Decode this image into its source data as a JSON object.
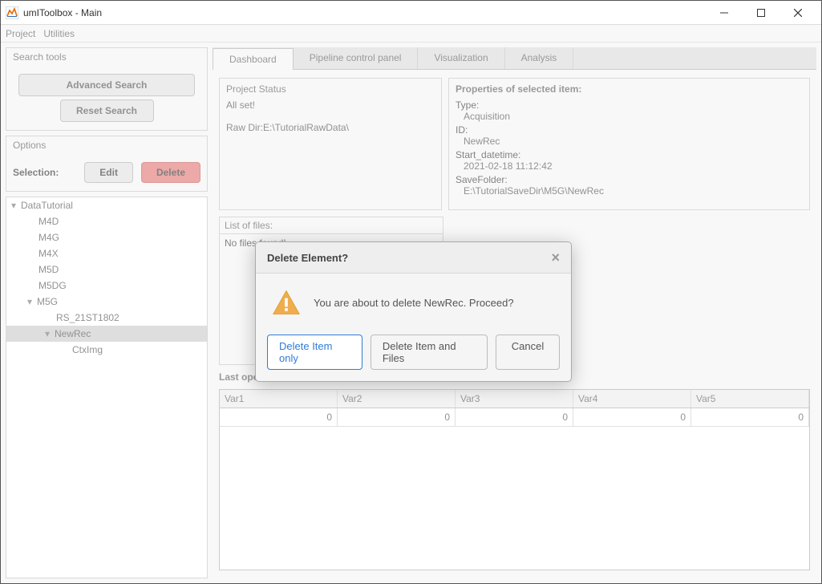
{
  "window": {
    "title": "umIToolbox - Main"
  },
  "menubar": [
    "Project",
    "Utilities"
  ],
  "search_panel": {
    "title": "Search tools",
    "advanced_btn": "Advanced Search",
    "reset_btn": "Reset Search"
  },
  "options_panel": {
    "title": "Options",
    "selection_label": "Selection:",
    "edit_btn": "Edit",
    "delete_btn": "Delete"
  },
  "tree": {
    "root": "DataTutorial",
    "items": [
      "M4D",
      "M4G",
      "M4X",
      "M5D",
      "M5DG"
    ],
    "m5g": "M5G",
    "m5g_children": [
      "RS_21ST1802"
    ],
    "newrec": "NewRec",
    "newrec_children": [
      "CtxImg"
    ]
  },
  "tabs": [
    "Dashboard",
    "Pipeline control panel",
    "Visualization",
    "Analysis"
  ],
  "project_status": {
    "title": "Project Status",
    "line1": "All set!",
    "line2": "Raw Dir:E:\\TutorialRawData\\"
  },
  "properties": {
    "title": "Properties of selected item:",
    "type_key": "Type:",
    "type_val": "Acquisition",
    "id_key": "ID:",
    "id_val": "NewRec",
    "start_key": "Start_datetime:",
    "start_val": "2021-02-18 11:12:42",
    "save_key": "SaveFolder:",
    "save_val": "E:\\TutorialSaveDir\\M5G\\NewRec"
  },
  "files": {
    "title": "List of files:",
    "body": "No files found!"
  },
  "lastops": {
    "title": "Last operations in selected Item:",
    "headers": [
      "Var1",
      "Var2",
      "Var3",
      "Var4",
      "Var5"
    ],
    "row": [
      "0",
      "0",
      "0",
      "0",
      "0"
    ]
  },
  "dialog": {
    "title": "Delete Element?",
    "message": "You are about to delete NewRec. Proceed?",
    "btn_item_only": "Delete Item only",
    "btn_item_files": "Delete Item and Files",
    "btn_cancel": "Cancel"
  }
}
